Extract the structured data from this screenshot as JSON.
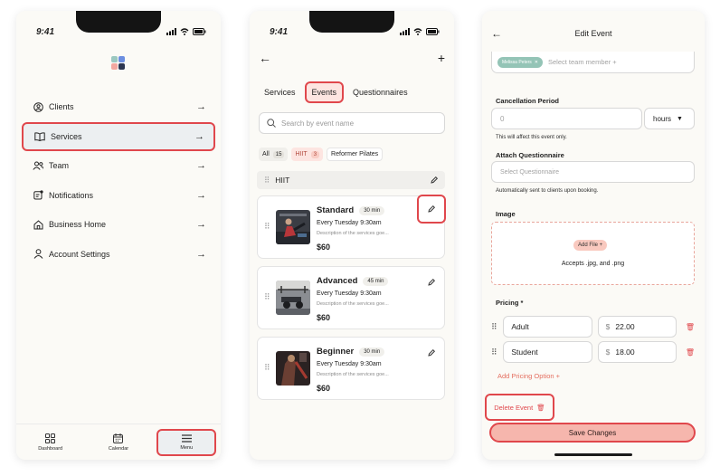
{
  "status_time": "9:41",
  "menu_screen": {
    "items": [
      {
        "label": "Clients",
        "icon": "user-circle-icon"
      },
      {
        "label": "Services",
        "icon": "book-icon"
      },
      {
        "label": "Team",
        "icon": "team-icon"
      },
      {
        "label": "Notifications",
        "icon": "notification-icon"
      },
      {
        "label": "Business Home",
        "icon": "home-icon"
      },
      {
        "label": "Account Settings",
        "icon": "account-icon"
      }
    ],
    "tabbar": [
      {
        "label": "Dashboard",
        "icon": "grid-icon"
      },
      {
        "label": "Calendar",
        "icon": "calendar-icon"
      },
      {
        "label": "Menu",
        "icon": "hamburger-icon"
      }
    ]
  },
  "events_screen": {
    "tabs": [
      "Services",
      "Events",
      "Questionnaires"
    ],
    "search_placeholder": "Search by event name",
    "filters": [
      {
        "label": "All",
        "count": "15"
      },
      {
        "label": "HIIT",
        "count": "3"
      },
      {
        "label": "Reformer Pilates",
        "count": ""
      }
    ],
    "group_title": "HIIT",
    "events": [
      {
        "title": "Standard",
        "duration": "30 min",
        "schedule": "Every Tuesday 9:30am",
        "description": "Description of the services goe...",
        "price": "$60"
      },
      {
        "title": "Advanced",
        "duration": "45 min",
        "schedule": "Every Tuesday 9:30am",
        "description": "Description of the services goe...",
        "price": "$60"
      },
      {
        "title": "Beginner",
        "duration": "30 min",
        "schedule": "Every Tuesday 9:30am",
        "description": "Description of the services goe...",
        "price": "$60"
      }
    ]
  },
  "edit_screen": {
    "title": "Edit Event",
    "team_tag": "Melissa Peters",
    "team_placeholder": "Select team member +",
    "cancellation_label": "Cancellation Period",
    "cancellation_value": "0",
    "cancellation_unit": "hours",
    "cancellation_hint": "This will affect this event only.",
    "questionnaire_label": "Attach Questionnaire",
    "questionnaire_placeholder": "Select Questionnaire",
    "questionnaire_hint": "Automatically sent to clients upon booking.",
    "image_label": "Image",
    "add_file": "Add File +",
    "accepts": "Accepts .jpg, and .png",
    "pricing_label": "Pricing *",
    "pricing": [
      {
        "name": "Adult",
        "currency": "$",
        "amount": "22.00"
      },
      {
        "name": "Student",
        "currency": "$",
        "amount": "18.00"
      }
    ],
    "add_pricing": "Add Pricing Option  +",
    "delete_event": "Delete Event",
    "save_changes": "Save Changes"
  },
  "colors": {
    "highlight": "#e0474c",
    "accent": "#e46e5f",
    "tag": "#94c4b6",
    "save_fill": "#f6b6ad"
  }
}
